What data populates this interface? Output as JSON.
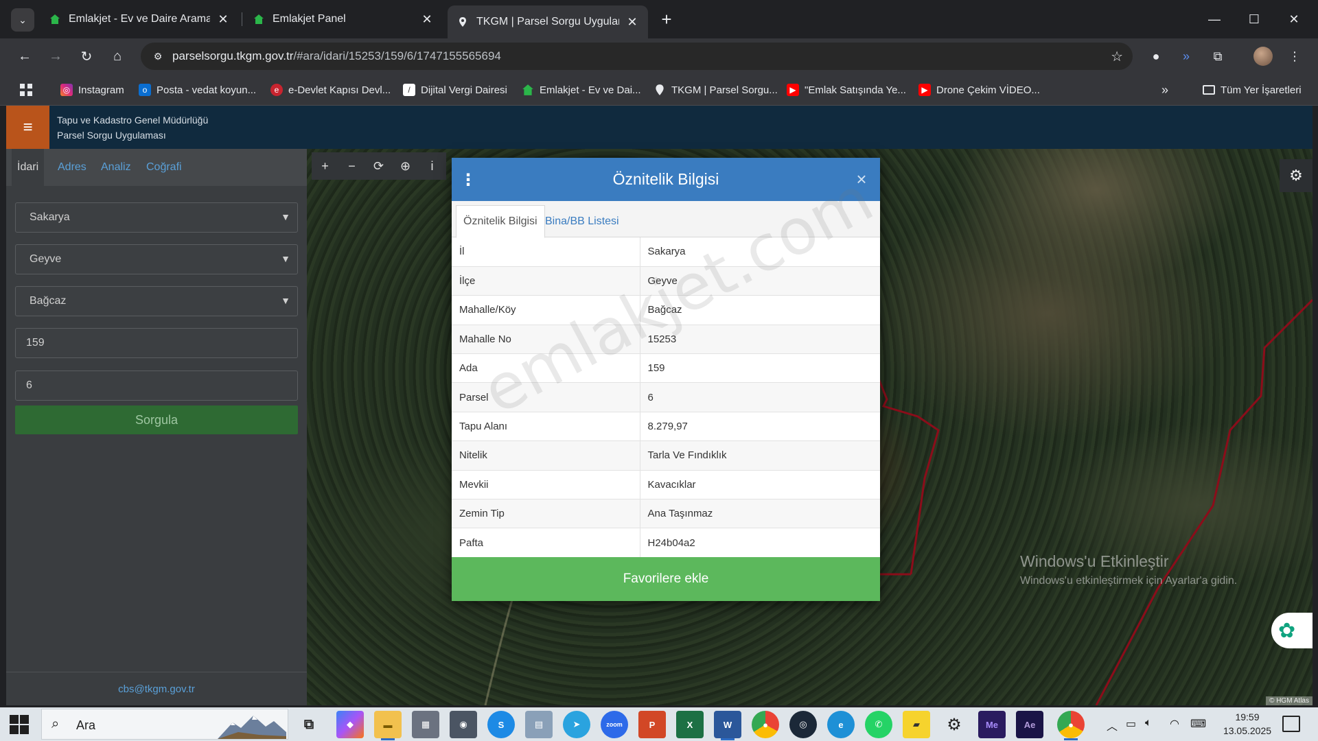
{
  "browser": {
    "tabs": [
      {
        "title": "Emlakjet - Ev ve Daire Aramanın"
      },
      {
        "title": "Emlakjet Panel"
      },
      {
        "title": "TKGM | Parsel Sorgu Uygulaması"
      }
    ],
    "url_host": "parselsorgu.tkgm.gov.tr",
    "url_path": "/#ara/idari/15253/159/6/1747155565694",
    "bookmarks": [
      {
        "label": "Instagram"
      },
      {
        "label": "Posta - vedat koyun..."
      },
      {
        "label": "e-Devlet Kapısı Devl..."
      },
      {
        "label": "Dijital Vergi Dairesi"
      },
      {
        "label": "Emlakjet - Ev ve Dai..."
      },
      {
        "label": "TKGM | Parsel Sorgu..."
      },
      {
        "label": "\"Emlak Satışında Ye..."
      },
      {
        "label": "Drone Çekim VİDEO..."
      }
    ],
    "all_bookmarks": "Tüm Yer İşaretleri"
  },
  "app": {
    "title_line1": "Tapu ve Kadastro Genel Müdürlüğü",
    "title_line2": "Parsel Sorgu Uygulaması"
  },
  "sidebar": {
    "tabs": [
      "İdari",
      "Adres",
      "Analiz",
      "Coğrafi"
    ],
    "il": "Sakarya",
    "ilce": "Geyve",
    "mahalle": "Bağcaz",
    "ada": "159",
    "parsel": "6",
    "submit": "Sorgula",
    "footer_email": "cbs@tkgm.gov.tr"
  },
  "dialog": {
    "title": "Öznitelik Bilgisi",
    "tabs": [
      "Öznitelik Bilgisi",
      "Bina/BB Listesi"
    ],
    "rows": [
      {
        "key": "İl",
        "value": "Sakarya"
      },
      {
        "key": "İlçe",
        "value": "Geyve"
      },
      {
        "key": "Mahalle/Köy",
        "value": "Bağcaz"
      },
      {
        "key": "Mahalle No",
        "value": "15253"
      },
      {
        "key": "Ada",
        "value": "159"
      },
      {
        "key": "Parsel",
        "value": "6"
      },
      {
        "key": "Tapu Alanı",
        "value": "8.279,97"
      },
      {
        "key": "Nitelik",
        "value": "Tarla Ve Fındıklık"
      },
      {
        "key": "Mevkii",
        "value": "Kavacıklar"
      },
      {
        "key": "Zemin Tip",
        "value": "Ana Taşınmaz"
      },
      {
        "key": "Pafta",
        "value": "H24b04a2"
      }
    ],
    "button": "Favorilere ekle",
    "watermark": "emlakjet.com"
  },
  "map": {
    "activation_title": "Windows'u Etkinleştir",
    "activation_sub": "Windows'u etkinleştirmek için Ayarlar'a gidin.",
    "attribution": "© HGM Atlas"
  },
  "taskbar": {
    "search_placeholder": "Ara",
    "time": "19:59",
    "date": "13.05.2025"
  },
  "colors": {
    "dialog_header": "#3a7cc0",
    "favorite_button": "#5cb85c",
    "sorgula_button": "#2e6a33",
    "hamburger": "#b9541b",
    "parcel_outline": "#8b0d1a"
  }
}
